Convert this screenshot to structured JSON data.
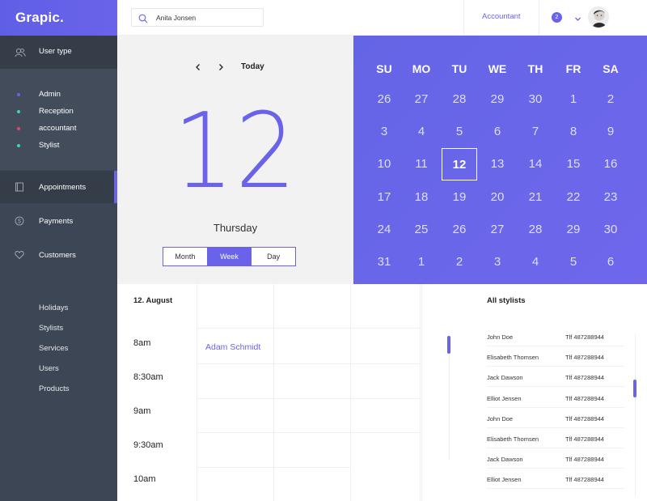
{
  "app": {
    "logo": "Grapic."
  },
  "sidebar": {
    "user_type": "User type",
    "roles": [
      {
        "label": "Admin",
        "color": "#6a63ea"
      },
      {
        "label": "Reception",
        "color": "#3ed3c0"
      },
      {
        "label": "accountant",
        "color": "#e8426d"
      },
      {
        "label": "Stylist",
        "color": "#3ed3c0"
      }
    ],
    "nav": [
      {
        "label": "Appointments",
        "icon": "book-icon",
        "active": true
      },
      {
        "label": "Payments",
        "icon": "dollar-icon",
        "active": false
      },
      {
        "label": "Customers",
        "icon": "heart-icon",
        "active": false
      }
    ],
    "sub": [
      "Holidays",
      "Stylists",
      "Services",
      "Users",
      "Products"
    ]
  },
  "header": {
    "search_value": "Anita Jonsen",
    "role": "Accountant",
    "notifications": "2"
  },
  "day": {
    "today_label": "Today",
    "number": "12",
    "weekday": "Thursday",
    "views": [
      "Month",
      "Week",
      "Day"
    ],
    "active_view": "Week"
  },
  "calendar": {
    "weekdays": [
      "SU",
      "MO",
      "TU",
      "WE",
      "TH",
      "FR",
      "SA"
    ],
    "weeks": [
      [
        "26",
        "27",
        "28",
        "29",
        "30",
        "1",
        "2"
      ],
      [
        "3",
        "4",
        "5",
        "6",
        "7",
        "8",
        "9"
      ],
      [
        "10",
        "11",
        "12",
        "13",
        "14",
        "15",
        "16"
      ],
      [
        "17",
        "18",
        "19",
        "20",
        "21",
        "22",
        "23"
      ],
      [
        "24",
        "25",
        "26",
        "27",
        "28",
        "29",
        "30"
      ],
      [
        "31",
        "1",
        "2",
        "3",
        "4",
        "5",
        "6"
      ]
    ],
    "selected": "12"
  },
  "schedule": {
    "date": "12. August",
    "times": [
      "8am",
      "8:30am",
      "9am",
      "9:30am",
      "10am"
    ],
    "appointment": "Adam Schmidt"
  },
  "stylists": {
    "title": "All stylists",
    "rows": [
      {
        "name": "John Doe",
        "phone": "Tlf 487288944"
      },
      {
        "name": "Elisabeth Thomsen",
        "phone": "Tlf 487288944"
      },
      {
        "name": "Jack Dawson",
        "phone": "Tlf 487288944"
      },
      {
        "name": "Elliot Jensen",
        "phone": "Tlf 487288944"
      },
      {
        "name": "John Doe",
        "phone": "Tlf 487288944"
      },
      {
        "name": "Elisabeth Thomsen",
        "phone": "Tlf 487288944"
      },
      {
        "name": "Jack Dawson",
        "phone": "Tlf 487288944"
      },
      {
        "name": "Elliot Jensen",
        "phone": "Tlf 487288944"
      }
    ]
  }
}
